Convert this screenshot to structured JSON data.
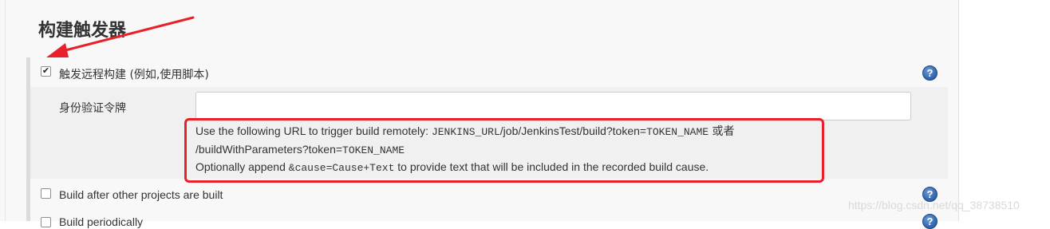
{
  "section": {
    "title": "构建触发器"
  },
  "remote_trigger": {
    "checked": true,
    "label": "触发远程构建 (例如,使用脚本)",
    "help": "?"
  },
  "auth_token": {
    "label": "身份验证令牌",
    "value": "",
    "placeholder": ""
  },
  "description": {
    "line1_text": "Use the following URL to trigger build remotely: ",
    "line1_code": "JENKINS_URL",
    "line1_text2": "/job/JenkinsTest/build?token=",
    "line1_code2": "TOKEN_NAME",
    "line1_or": " 或者",
    "line2_text": "/buildWithParameters?token=",
    "line2_code": "TOKEN_NAME",
    "line3_text": "Optionally append ",
    "line3_code": "&cause=Cause+Text",
    "line3_text2": " to provide text that will be included in the recorded build cause."
  },
  "after_other": {
    "checked": false,
    "label": "Build after other projects are built",
    "help": "?"
  },
  "periodic": {
    "checked": false,
    "label": "Build periodically",
    "help": "?"
  },
  "watermark": "https://blog.csdn.net/qq_38738510",
  "colors": {
    "annotation_red": "#e8202a",
    "help_blue": "#3569b0"
  }
}
